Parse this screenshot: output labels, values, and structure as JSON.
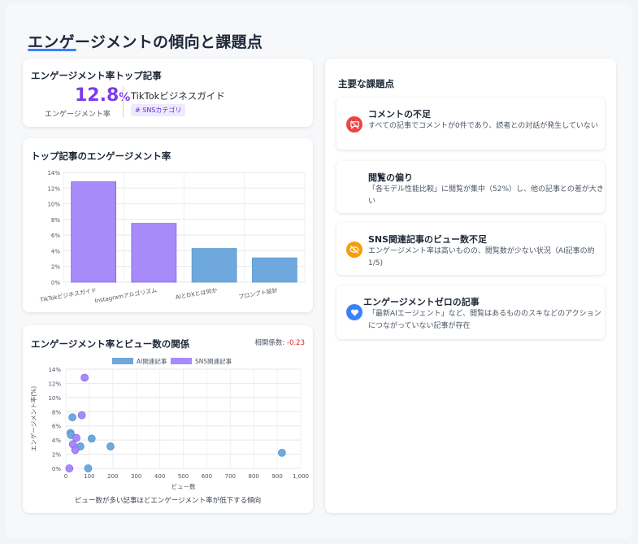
{
  "page_title": "エンゲージメントの傾向と課題点",
  "colors": {
    "accent": "#3b82f6",
    "purple": "#a78bfa",
    "blue": "#6ea8dd",
    "red": "#ef4444",
    "orange": "#f59e0b"
  },
  "top_article": {
    "title": "エンゲージメント率トップ記事",
    "value": "12.8",
    "unit": "%",
    "label": "エンゲージメント率",
    "article": "TikTokビジネスガイド",
    "tag": "# SNSカテゴリ"
  },
  "bar_card": {
    "title": "トップ記事のエンゲージメント率"
  },
  "scatter_card": {
    "title": "エンゲージメント率とビュー数の関係",
    "corr_label": "相関係数: ",
    "corr_value": "-0.23",
    "caption": "ビュー数が多い記事ほどエンゲージメント率が低下する傾向"
  },
  "chart_data": [
    {
      "type": "bar",
      "categories": [
        "TikTokビジネスガイド",
        "Instagramアルゴリズム",
        "AIとDXとは何か",
        "プロンプト設計"
      ],
      "values": [
        12.8,
        7.5,
        4.3,
        3.1
      ],
      "bar_colors": [
        "#a78bfa",
        "#a78bfa",
        "#6ea8dd",
        "#6ea8dd"
      ],
      "ylim": [
        0,
        14
      ],
      "yticks": [
        "0%",
        "2%",
        "4%",
        "6%",
        "8%",
        "10%",
        "12%",
        "14%"
      ]
    },
    {
      "type": "scatter",
      "xlabel": "ビュー数",
      "ylabel": "エンゲージメント率(%)",
      "xlim": [
        0,
        1000
      ],
      "ylim": [
        0,
        14
      ],
      "xticks": [
        "0",
        "100",
        "200",
        "300",
        "400",
        "500",
        "600",
        "700",
        "800",
        "900",
        "1,000"
      ],
      "yticks": [
        "0%",
        "2%",
        "4%",
        "6%",
        "8%",
        "10%",
        "12%",
        "14%"
      ],
      "series": [
        {
          "name": "AI関連記事",
          "color": "#6ea8dd",
          "points": [
            [
              20,
              5.0
            ],
            [
              22,
              4.7
            ],
            [
              28,
              7.2
            ],
            [
              62,
              3.1
            ],
            [
              110,
              4.2
            ],
            [
              190,
              3.1
            ],
            [
              95,
              0.0
            ],
            [
              920,
              2.2
            ]
          ]
        },
        {
          "name": "SNS関連記事",
          "color": "#a78bfa",
          "points": [
            [
              80,
              12.8
            ],
            [
              68,
              7.5
            ],
            [
              45,
              4.3
            ],
            [
              30,
              3.4
            ],
            [
              40,
              2.6
            ],
            [
              15,
              0.0
            ]
          ]
        }
      ]
    }
  ],
  "issues_card": {
    "title": "主要な課題点",
    "items": [
      {
        "title": "コメントの不足",
        "desc": "すべての記事でコメントが0件であり、読者との対話が発生していない",
        "icon": "no-comment-icon"
      },
      {
        "title": "閲覧の偏り",
        "desc": "「各モデル性能比較」に閲覧が集中（52%）し、他の記事との差が大きい",
        "icon": "chart-icon"
      },
      {
        "title": "SNS関連記事のビュー数不足",
        "desc": "エンゲージメント率は高いものの、閲覧数が少ない状況（AI記事の約1/5)",
        "icon": "eye-slash-icon"
      },
      {
        "title": "エンゲージメントゼロの記事",
        "desc": "「最新AIエージェント」など、閲覧はあるもののスキなどのアクションにつながっていない記事が存在",
        "icon": "heart-icon"
      }
    ]
  }
}
